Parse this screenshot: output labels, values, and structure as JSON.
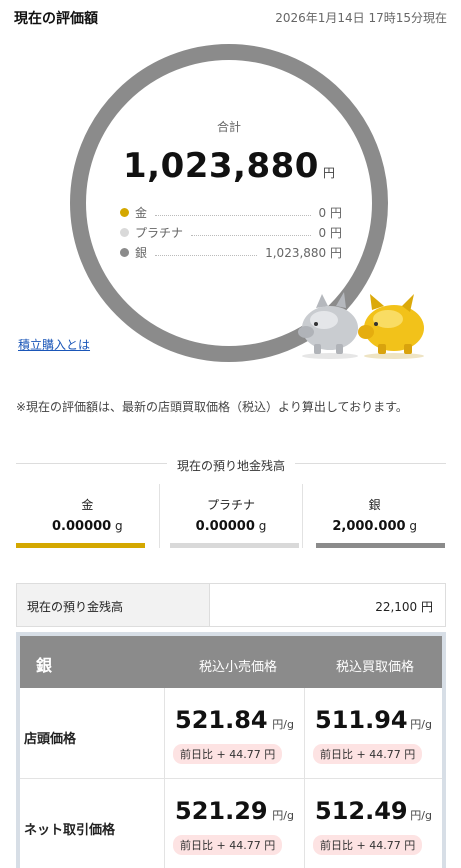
{
  "header": {
    "title": "現在の評価額",
    "timestamp": "2026年1月14日 17時15分現在"
  },
  "summary": {
    "total_label": "合計",
    "total_value": "1,023,880",
    "total_unit": "円",
    "ring_color": "#8b8b8b",
    "metals": [
      {
        "name": "金",
        "value": "0 円",
        "color": "#d4a800"
      },
      {
        "name": "プラチナ",
        "value": "0 円",
        "color": "#d9d9d9"
      },
      {
        "name": "銀",
        "value": "1,023,880 円",
        "color": "#8b8b8b"
      }
    ]
  },
  "links": {
    "reserve_purchase": "積立購入とは"
  },
  "note": "※現在の評価額は、最新の店頭買取価格（税込）より算出しております。",
  "holdings": {
    "heading": "現在の預り地金残高",
    "items": [
      {
        "name": "金",
        "amount": "0.00000",
        "unit": "g",
        "color": "#d4a800"
      },
      {
        "name": "プラチナ",
        "amount": "0.00000",
        "unit": "g",
        "color": "#d9d9d9"
      },
      {
        "name": "銀",
        "amount": "2,000.000",
        "unit": "g",
        "color": "#8b8b8b"
      }
    ]
  },
  "cash": {
    "label": "現在の預り金残高",
    "value": "22,100 円"
  },
  "prices": {
    "metal": "銀",
    "col_retail": "税込小売価格",
    "col_buyback": "税込買取価格",
    "rows": [
      {
        "label": "店頭価格",
        "retail": {
          "price": "521.84",
          "unit": "円/g",
          "diff": "前日比 + 44.77 円"
        },
        "buyback": {
          "price": "511.94",
          "unit": "円/g",
          "diff": "前日比 + 44.77 円"
        }
      },
      {
        "label": "ネット取引価格",
        "retail": {
          "price": "521.29",
          "unit": "円/g",
          "diff": "前日比 + 44.77 円"
        },
        "buyback": {
          "price": "512.49",
          "unit": "円/g",
          "diff": "前日比 + 44.77 円"
        }
      }
    ]
  }
}
